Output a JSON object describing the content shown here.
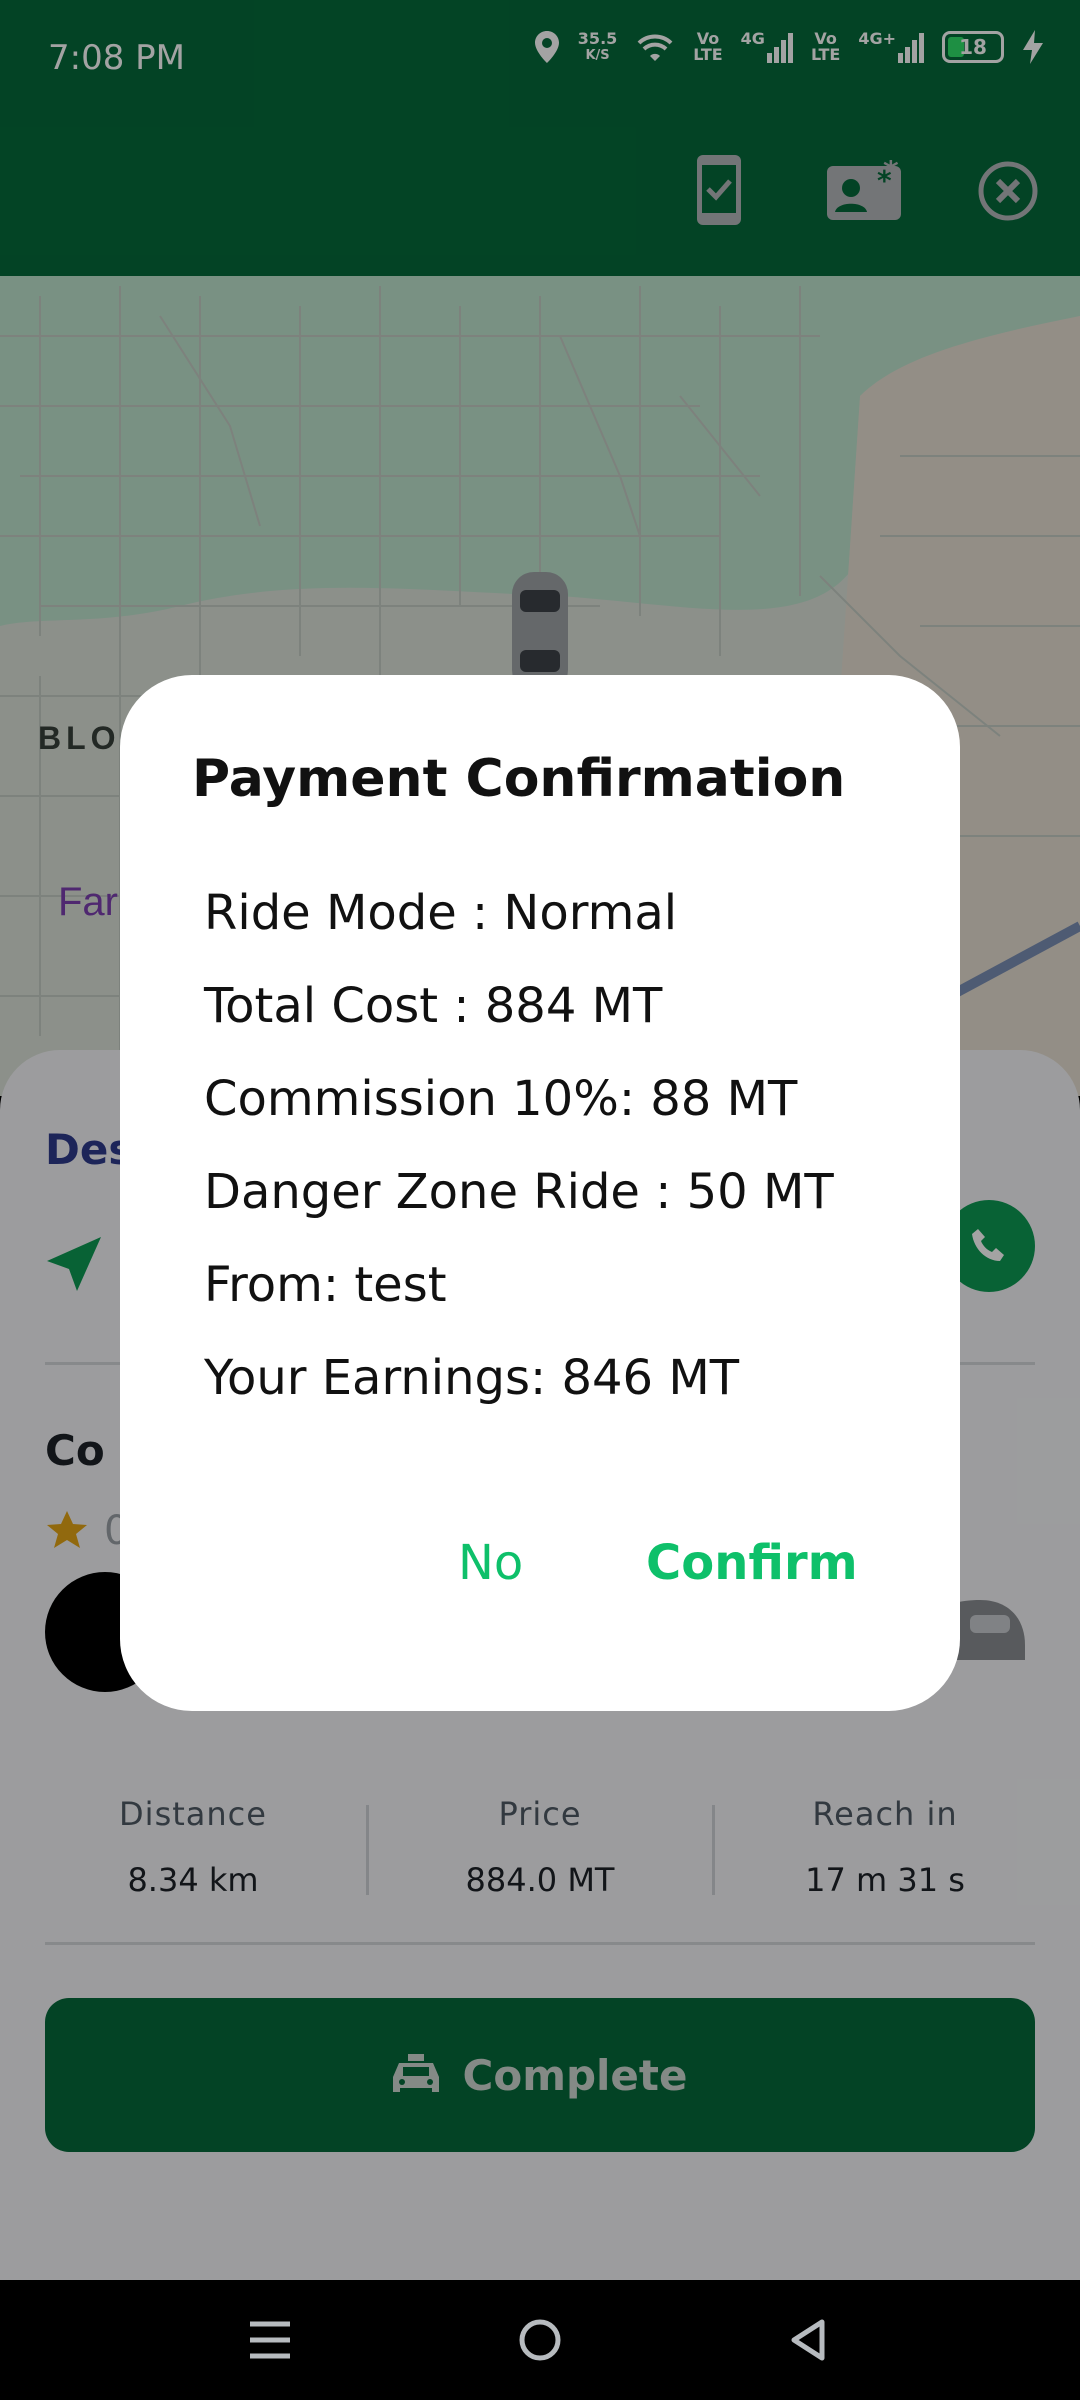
{
  "status_bar": {
    "time": "7:08 PM",
    "net_speed_value": "35.5",
    "net_speed_unit": "K/S",
    "sim1_tech": "Vo",
    "sim1_tech2": "LTE",
    "sim1_gen": "4G",
    "sim2_tech": "Vo",
    "sim2_tech2": "LTE",
    "sim2_gen": "4G+",
    "battery": "18",
    "icons": [
      "location-icon",
      "wifi-icon",
      "signal-icon",
      "signal-icon",
      "battery-icon",
      "charging-icon"
    ]
  },
  "header": {
    "icons": [
      "phone-check-icon",
      "contact-card-icon",
      "close-circle-icon"
    ],
    "color": "#056a3a"
  },
  "map": {
    "label_block": "BLOC",
    "label_area": "Far"
  },
  "sheet": {
    "destination_title": "Des",
    "contact_title": "Co",
    "rating_partial": "0",
    "stats": [
      {
        "label": "Distance",
        "value": "8.34 km"
      },
      {
        "label": "Price",
        "value": "884.0 MT"
      },
      {
        "label": "Reach in",
        "value": "17 m 31 s"
      }
    ],
    "complete_label": "Complete"
  },
  "dialog": {
    "title": "Payment Confirmation",
    "lines": [
      "Ride Mode : Normal",
      "Total Cost : 884 MT",
      "Commission 10%: 88 MT",
      "Danger Zone Ride : 50 MT",
      "From: test",
      "Your Earnings: 846 MT"
    ],
    "no_label": "No",
    "confirm_label": "Confirm"
  },
  "colors": {
    "primary": "#056a3a",
    "accent": "#0ec06a"
  }
}
